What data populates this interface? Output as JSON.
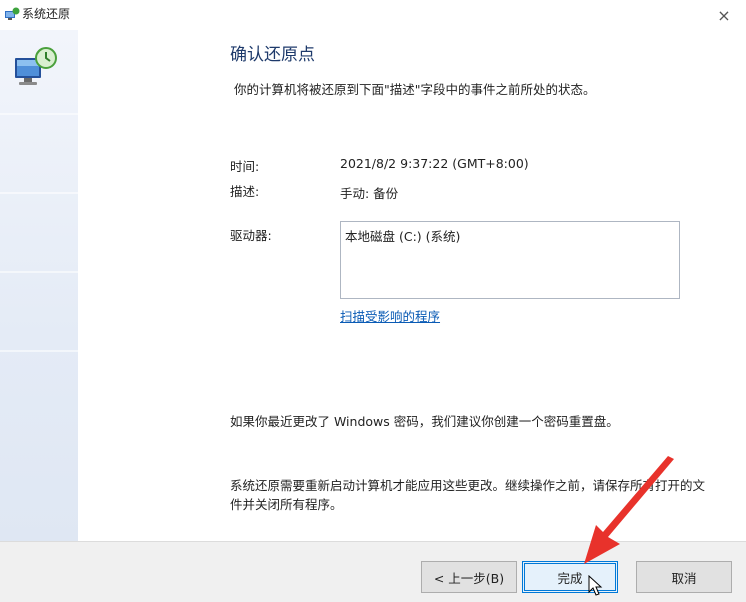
{
  "window": {
    "title": "系统还原",
    "icons": {
      "app": "system-restore-icon",
      "close": "close-icon"
    },
    "close_glyph": "×"
  },
  "sidebar": {
    "icon": "system-restore-computer-icon"
  },
  "main": {
    "heading": "确认还原点",
    "subtitle": "你的计算机将被还原到下面\"描述\"字段中的事件之前所处的状态。",
    "fields": {
      "time_label": "时间:",
      "time_value": "2021/8/2 9:37:22 (GMT+8:00)",
      "description_label": "描述:",
      "description_value": "手动: 备份",
      "drives_label": "驱动器:",
      "drives": [
        "本地磁盘 (C:) (系统)"
      ]
    },
    "scan_link": "扫描受影响的程序",
    "password_notice": "如果你最近更改了 Windows 密码，我们建议你创建一个密码重置盘。",
    "restart_notice": "系统还原需要重新启动计算机才能应用这些更改。继续操作之前，请保存所有打开的文件并关闭所有程序。"
  },
  "footer": {
    "back_button": "< 上一步(B)",
    "finish_button": "完成",
    "cancel_button": "取消"
  },
  "overlay": {
    "arrow_color": "#e8322b",
    "pointer": "mouse-cursor-icon"
  }
}
